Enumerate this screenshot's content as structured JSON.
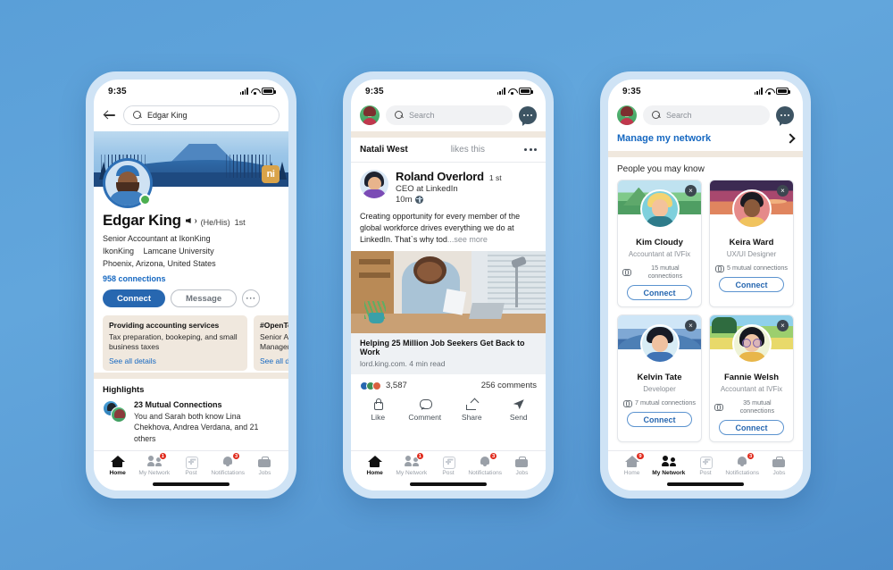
{
  "background": {
    "accent": "#2767b0",
    "page_gradient_from": "#5a9fd8",
    "page_gradient_to": "#4d8ecb"
  },
  "status_bar": {
    "time": "9:35"
  },
  "phone1": {
    "search": {
      "value": "Edgar King",
      "placeholder": "Search"
    },
    "profile": {
      "name": "Edgar King",
      "pronouns": "(He/His)",
      "degree": "1st",
      "headline": "Senior Accountant at IkonKing",
      "company": "IkonKing",
      "school": "Lamcane University",
      "location": "Phoenix, Arizona, United States",
      "connections": "958 connections",
      "badge_initials": "ni"
    },
    "actions": {
      "connect": "Connect",
      "message": "Message",
      "more": "···"
    },
    "info_cards": [
      {
        "title": "Providing accounting services",
        "body": "Tax preparation, bookeping, and small business taxes",
        "link": "See all details"
      },
      {
        "title": "#OpenToWork",
        "body": "Senior Accountant, Manager",
        "link": "See all details"
      }
    ],
    "highlights": {
      "title": "Highlights",
      "item_title": "23 Mutual Connections",
      "item_body": "You and Sarah both know Lina Chekhova, Andrea Verdana, and 21 others"
    },
    "tabs": [
      {
        "label": "Home",
        "icon": "home-icon",
        "active": true,
        "badge": ""
      },
      {
        "label": "My Network",
        "icon": "network-icon",
        "active": false,
        "badge": "1"
      },
      {
        "label": "Post",
        "icon": "post-icon",
        "active": false,
        "badge": ""
      },
      {
        "label": "Notifictations",
        "icon": "bell-icon",
        "active": false,
        "badge": "3"
      },
      {
        "label": "Jobs",
        "icon": "briefcase-icon",
        "active": false,
        "badge": ""
      }
    ]
  },
  "phone2": {
    "search": {
      "placeholder": "Search"
    },
    "likes_banner": {
      "name": "Natali West",
      "action": "likes this"
    },
    "post": {
      "author": "Roland Overlord",
      "degree": "1 st",
      "title": "CEO at LinkedIn",
      "time": "10m",
      "text": "Creating opportunity for every member of the global workforce drives everything we do at LinkedIn. That`s why tod",
      "see_more": "...see more",
      "article_title": "Helping 25 Million Job Seekers Get Back to Work",
      "article_meta": "lord.king.com. 4 min read",
      "reactions": "3,587",
      "comments": "256 comments"
    },
    "post_actions": [
      {
        "label": "Like",
        "icon": "thumbs-up-icon"
      },
      {
        "label": "Comment",
        "icon": "comment-icon"
      },
      {
        "label": "Share",
        "icon": "share-icon"
      },
      {
        "label": "Send",
        "icon": "send-icon"
      }
    ],
    "tabs": [
      {
        "label": "Home",
        "icon": "home-icon",
        "active": true,
        "badge": ""
      },
      {
        "label": "My Network",
        "icon": "network-icon",
        "active": false,
        "badge": "1"
      },
      {
        "label": "Post",
        "icon": "post-icon",
        "active": false,
        "badge": ""
      },
      {
        "label": "Notifictations",
        "icon": "bell-icon",
        "active": false,
        "badge": "3"
      },
      {
        "label": "Jobs",
        "icon": "briefcase-icon",
        "active": false,
        "badge": ""
      }
    ]
  },
  "phone3": {
    "search": {
      "placeholder": "Search"
    },
    "manage": {
      "label": "Manage my network"
    },
    "section_title": "People you may know",
    "connect_label": "Connect",
    "close_label": "×",
    "people": [
      {
        "name": "Kim Cloudy",
        "role": "Accountant at IVFix",
        "mutuals": "15 mutual connections"
      },
      {
        "name": "Keira Ward",
        "role": "UX/UI Designer",
        "mutuals": "5 mutual connections"
      },
      {
        "name": "Kelvin Tate",
        "role": "Developer",
        "mutuals": "7 mutual connections"
      },
      {
        "name": "Fannie Welsh",
        "role": "Accountant at IVFix",
        "mutuals": "35 mutual connections"
      }
    ],
    "tabs": [
      {
        "label": "Home",
        "icon": "home-icon",
        "active": false,
        "badge": "9"
      },
      {
        "label": "My Network",
        "icon": "network-icon",
        "active": true,
        "badge": ""
      },
      {
        "label": "Post",
        "icon": "post-icon",
        "active": false,
        "badge": ""
      },
      {
        "label": "Notifictations",
        "icon": "bell-icon",
        "active": false,
        "badge": "3"
      },
      {
        "label": "Jobs",
        "icon": "briefcase-icon",
        "active": false,
        "badge": ""
      }
    ]
  }
}
